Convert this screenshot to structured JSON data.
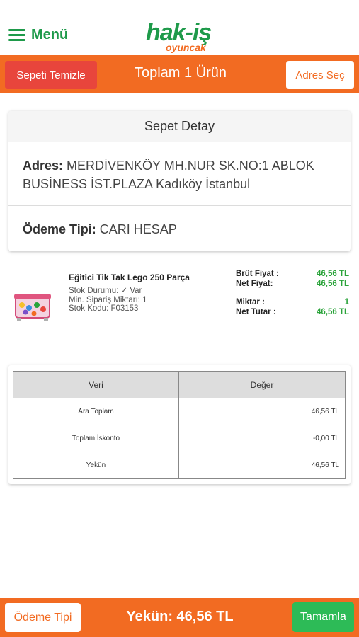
{
  "header": {
    "menu_label": "Menü",
    "logo_main": "hak-iş",
    "logo_sub": "oyuncak"
  },
  "actionbar": {
    "clear_label": "Sepeti Temizle",
    "title": "Toplam 1 Ürün",
    "address_label": "Adres Seç"
  },
  "detail": {
    "title": "Sepet Detay",
    "address_label": "Adres:",
    "address_value": "MERDİVENKÖY MH.NUR SK.NO:1 ABLOK BUSİNESS İST.PLAZA Kadıköy İstanbul",
    "payment_label": "Ödeme Tipi:",
    "payment_value": "CARI HESAP"
  },
  "product": {
    "name": "Eğitici Tik Tak Lego 250 Parça",
    "stock_status": "Stok Durumu: ✓ Var",
    "min_order": "Min. Sipariş Miktarı: 1",
    "stock_code": "Stok Kodu: F03153",
    "gross_label": "Brüt Fiyat :",
    "gross_value": "46,56 TL",
    "net_label": "Net Fiyat:",
    "net_value": "46,56 TL",
    "qty_label": "Miktar :",
    "qty_value": "1",
    "net_total_label": "Net Tutar :",
    "net_total_value": "46,56 TL"
  },
  "summary": {
    "col_key": "Veri",
    "col_value": "Değer",
    "rows": [
      {
        "key": "Ara Toplam",
        "value": "46,56 TL"
      },
      {
        "key": "Toplam İskonto",
        "value": "-0,00 TL"
      },
      {
        "key": "Yekün",
        "value": "46,56 TL"
      }
    ]
  },
  "bottombar": {
    "payment_type_label": "Ödeme Tipi",
    "total": "Yekün: 46,56 TL",
    "complete_label": "Tamamla"
  },
  "colors": {
    "brand_orange": "#f26b22",
    "brand_green": "#1e9a4a",
    "danger_red": "#e8453c",
    "success_green": "#2dbb57"
  }
}
